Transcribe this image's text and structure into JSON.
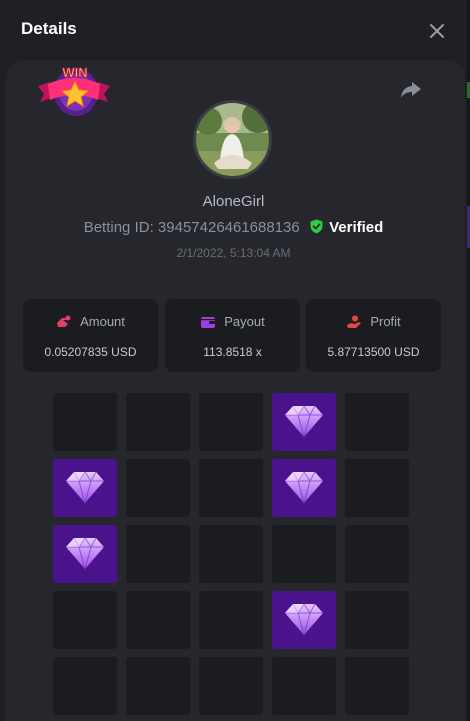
{
  "header": {
    "title": "Details"
  },
  "icons": {
    "close": "close-icon",
    "share": "share-icon",
    "badge": "win-badge-icon",
    "verified": "shield-check-icon",
    "gem": "diamond-icon"
  },
  "badge": {
    "text": "WIN"
  },
  "player": {
    "username": "AloneGirl",
    "betting_id_label": "Betting ID:",
    "betting_id": "39457426461688136",
    "verified_label": "Verified",
    "datetime": "2/1/2022, 5:13:04 AM"
  },
  "stats": [
    {
      "label": "Amount",
      "value": "0.05207835 USD",
      "icon": "amount-icon",
      "color": "#e0406a"
    },
    {
      "label": "Payout",
      "value": "113.8518 x",
      "icon": "wallet-icon",
      "color": "#a03fe0"
    },
    {
      "label": "Profit",
      "value": "5.87713500 USD",
      "icon": "profit-icon",
      "color": "#e04a3f"
    }
  ],
  "board": {
    "rows": 5,
    "cols": 5,
    "gems": [
      [
        0,
        3
      ],
      [
        1,
        0
      ],
      [
        1,
        3
      ],
      [
        2,
        0
      ],
      [
        3,
        3
      ]
    ]
  },
  "colors": {
    "accent": "#4b138b",
    "verified": "#2ecc40",
    "background": "#1f2025",
    "card": "#26272c"
  }
}
